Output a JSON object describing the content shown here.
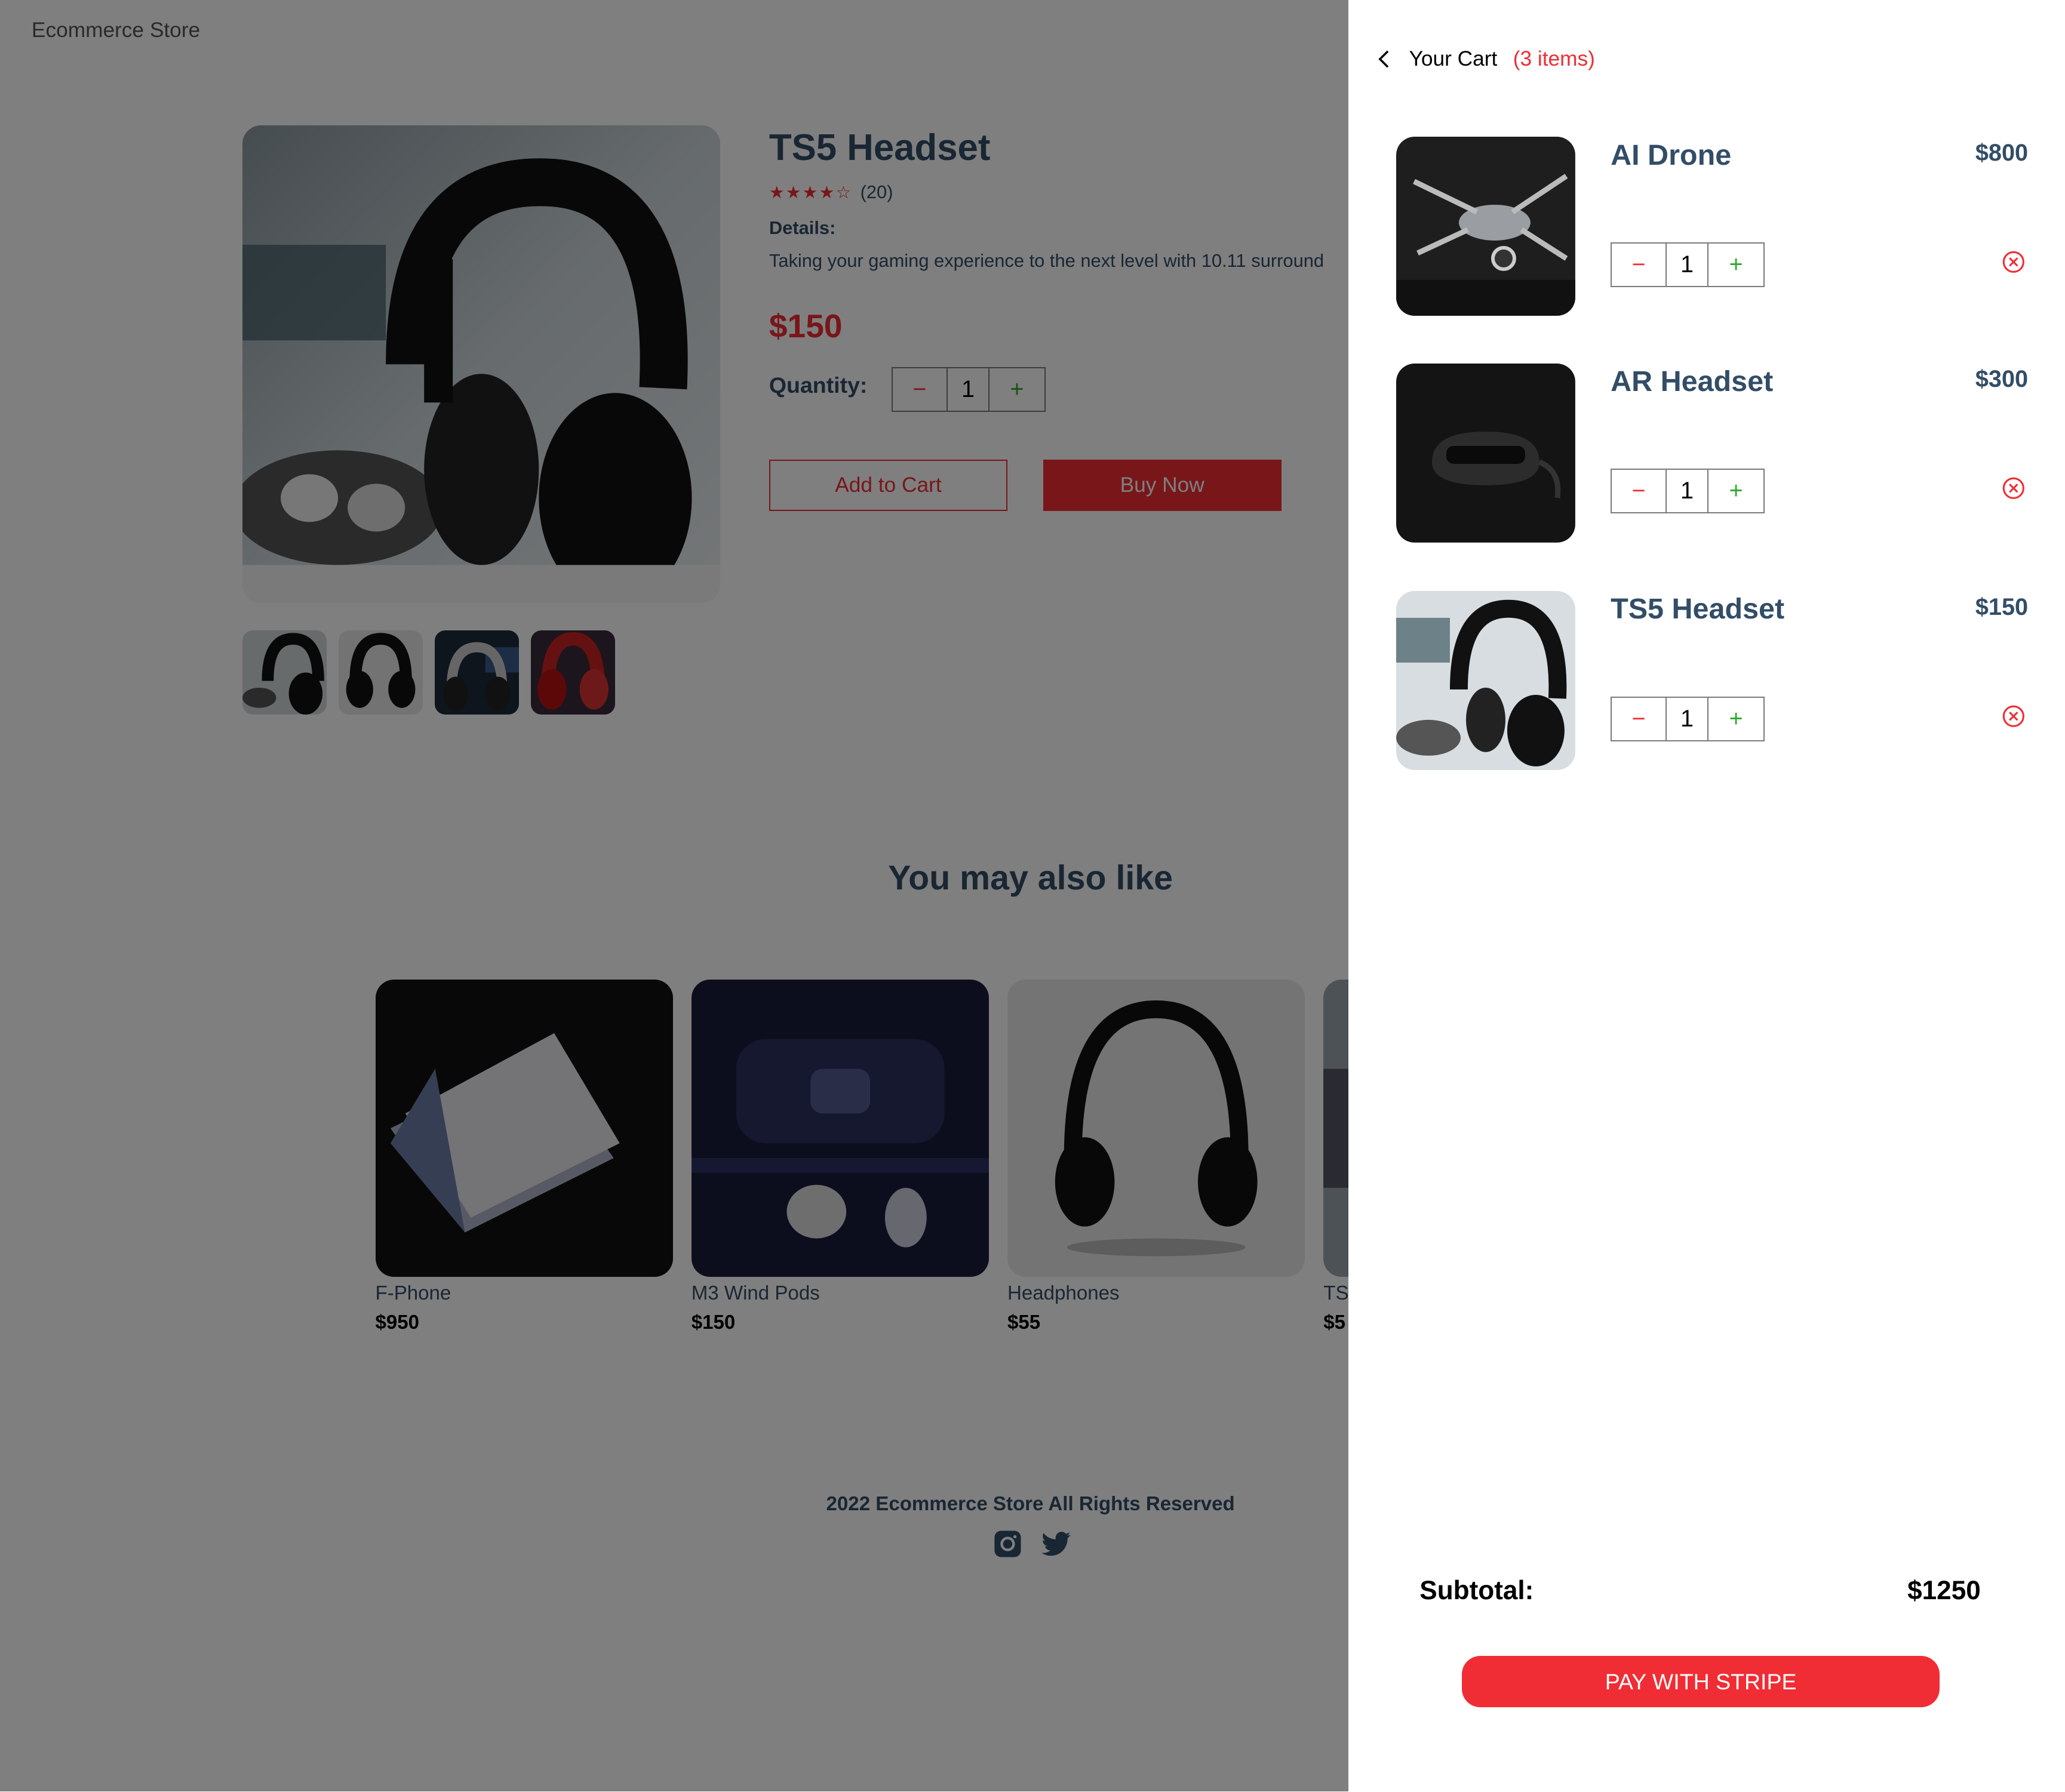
{
  "header": {
    "logo": "Ecommerce Store"
  },
  "product": {
    "title": "TS5 Headset",
    "stars": "★★★★☆",
    "reviews": "(20)",
    "details_heading": "Details:",
    "details_text": "Taking your gaming experience to the next level with 10.11 surround",
    "price": "$150",
    "quantity_label": "Quantity:",
    "quantity": "1",
    "minus": "−",
    "plus": "+",
    "add_to_cart": "Add to Cart",
    "buy_now": "Buy Now"
  },
  "may_also_like": {
    "heading": "You may also like",
    "items": [
      {
        "name": "F-Phone",
        "price": "$950"
      },
      {
        "name": "M3 Wind Pods",
        "price": "$150"
      },
      {
        "name": "Headphones",
        "price": "$55"
      },
      {
        "name": "TS",
        "price": "$5"
      }
    ]
  },
  "footer": {
    "text": "2022 Ecommerce Store All Rights Reserved",
    "icons": [
      "instagram-icon",
      "twitter-icon"
    ]
  },
  "cart": {
    "title": "Your Cart",
    "count": "(3 items)",
    "items": [
      {
        "name": "AI Drone",
        "price": "$800",
        "quantity": "1"
      },
      {
        "name": "AR Headset",
        "price": "$300",
        "quantity": "1"
      },
      {
        "name": "TS5 Headset",
        "price": "$150",
        "quantity": "1"
      }
    ],
    "subtotal_label": "Subtotal:",
    "subtotal_value": "$1250",
    "pay_button": "PAY WITH STRIPE"
  },
  "colors": {
    "accent": "#f02d34",
    "text": "#324d67",
    "plus": "#31a831"
  }
}
